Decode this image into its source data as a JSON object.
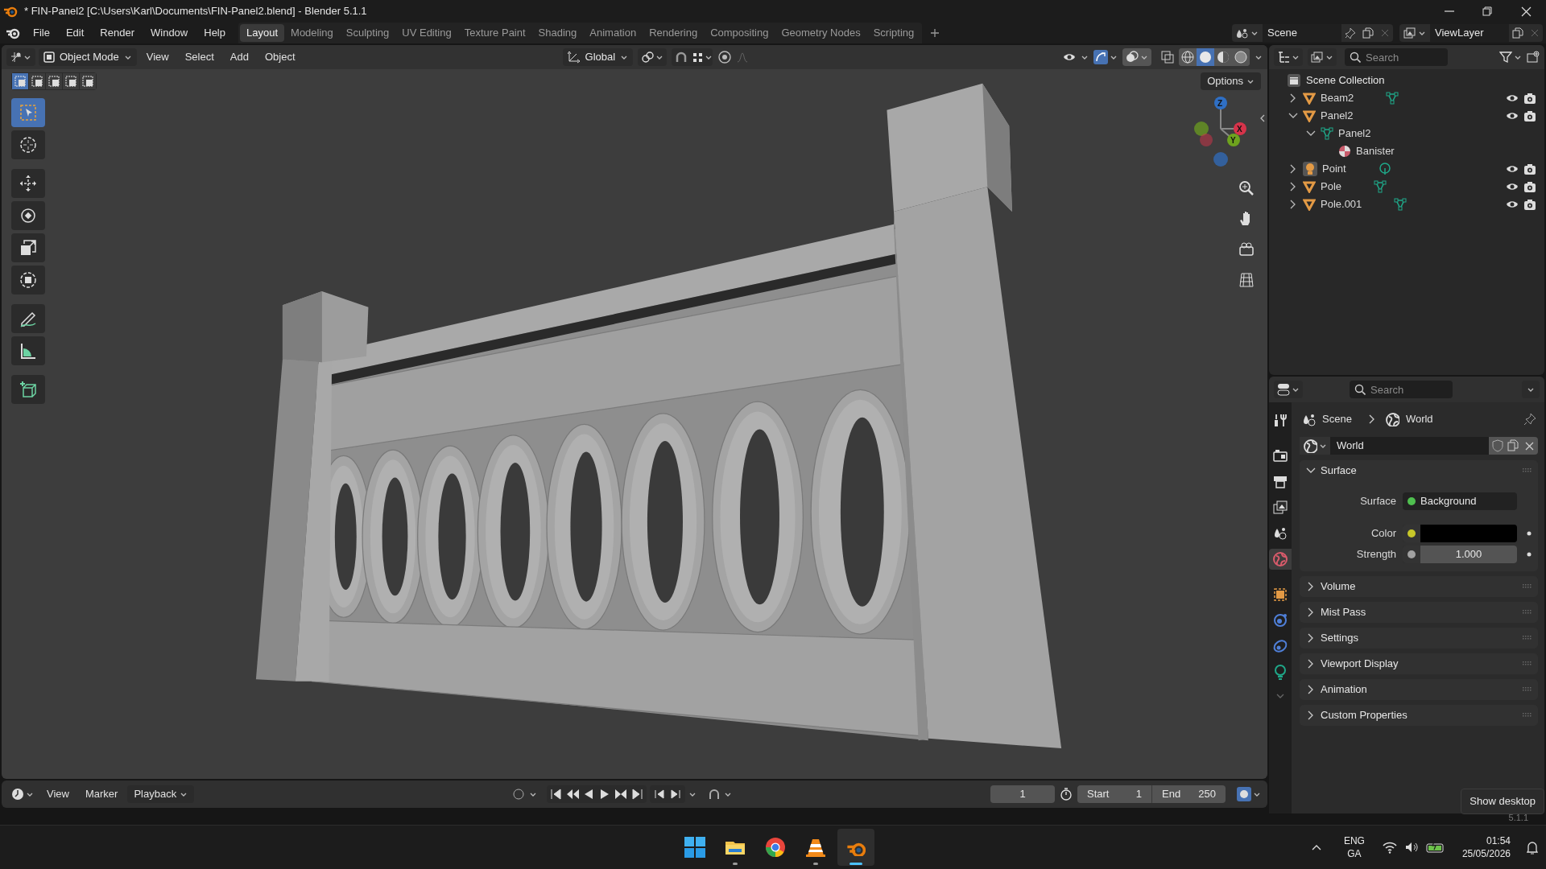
{
  "window": {
    "title": "* FIN-Panel2 [C:\\Users\\Karl\\Documents\\FIN-Panel2.blend] - Blender 5.1.1"
  },
  "menu": [
    "File",
    "Edit",
    "Render",
    "Window",
    "Help"
  ],
  "workspaces": [
    {
      "label": "Layout",
      "selected": true
    },
    {
      "label": "Modeling",
      "selected": false
    },
    {
      "label": "Sculpting",
      "selected": false
    },
    {
      "label": "UV Editing",
      "selected": false
    },
    {
      "label": "Texture Paint",
      "selected": false
    },
    {
      "label": "Shading",
      "selected": false
    },
    {
      "label": "Animation",
      "selected": false
    },
    {
      "label": "Rendering",
      "selected": false
    },
    {
      "label": "Compositing",
      "selected": false
    },
    {
      "label": "Geometry Nodes",
      "selected": false
    },
    {
      "label": "Scripting",
      "selected": false
    }
  ],
  "scene": "Scene",
  "view_layer": "ViewLayer",
  "viewport": {
    "mode": "Object Mode",
    "menus": [
      "View",
      "Select",
      "Add",
      "Object"
    ],
    "orientation": "Global",
    "options": "Options",
    "select_modes": [
      {
        "selected": true
      },
      {
        "selected": false
      },
      {
        "selected": false
      },
      {
        "selected": false
      },
      {
        "selected": false
      }
    ],
    "tools": [
      {
        "kind": "select",
        "selected": true
      },
      {
        "kind": "cursor",
        "selected": false
      },
      {
        "kind": "move",
        "selected": false
      },
      {
        "kind": "rotate",
        "selected": false
      },
      {
        "kind": "scale",
        "selected": false
      },
      {
        "kind": "transform",
        "selected": false
      },
      {
        "kind": "annotate",
        "selected": false
      },
      {
        "kind": "measure",
        "selected": false
      },
      {
        "kind": "add_cube",
        "selected": false
      }
    ],
    "shading": [
      {
        "kind": "wireframe",
        "selected": false
      },
      {
        "kind": "solid",
        "selected": true
      },
      {
        "kind": "material",
        "selected": false
      },
      {
        "kind": "rendered",
        "selected": false
      }
    ],
    "axes": [
      "Z",
      "X",
      "Y"
    ]
  },
  "outliner": {
    "search": {
      "placeholder": "Search"
    },
    "root": "Scene Collection",
    "items": [
      {
        "label": "Beam2",
        "kind": "mesh",
        "expanded": false,
        "visible": true,
        "data_icon": true
      },
      {
        "label": "Panel2",
        "kind": "mesh",
        "expanded": true,
        "visible": true,
        "children": [
          {
            "label": "Panel2",
            "kind": "mesh_data",
            "expanded": true,
            "children": [
              {
                "label": "Banister",
                "kind": "material"
              }
            ]
          }
        ]
      },
      {
        "label": "Point",
        "kind": "light",
        "expanded": false,
        "visible": true,
        "data_icon": true
      },
      {
        "label": "Pole",
        "kind": "mesh",
        "expanded": false,
        "visible": true,
        "data_icon": true
      },
      {
        "label": "Pole.001",
        "kind": "mesh",
        "expanded": false,
        "visible": true,
        "data_icon": true
      }
    ]
  },
  "properties": {
    "search": {
      "placeholder": "Search"
    },
    "breadcrumb": [
      "Scene",
      "World"
    ],
    "datablock": "World",
    "tabs": [
      {
        "kind": "tool",
        "selected": false
      },
      {
        "kind": "render",
        "selected": false
      },
      {
        "kind": "output",
        "selected": false
      },
      {
        "kind": "view_layer",
        "selected": false
      },
      {
        "kind": "scene",
        "selected": false
      },
      {
        "kind": "world",
        "selected": true
      },
      {
        "kind": "object",
        "selected": false
      },
      {
        "kind": "physics",
        "selected": false
      },
      {
        "kind": "constraints",
        "selected": false
      },
      {
        "kind": "data",
        "selected": false
      }
    ],
    "panels": [
      {
        "label": "Surface",
        "expanded": true,
        "fields": [
          {
            "label": "Surface",
            "kind": "shader",
            "value": "Background"
          },
          {
            "label": "Color",
            "kind": "color",
            "color": "#000000"
          },
          {
            "label": "Strength",
            "kind": "number",
            "value": "1.000"
          }
        ]
      },
      {
        "label": "Volume",
        "expanded": false
      },
      {
        "label": "Mist Pass",
        "expanded": false
      },
      {
        "label": "Settings",
        "expanded": false
      },
      {
        "label": "Viewport Display",
        "expanded": false
      },
      {
        "label": "Animation",
        "expanded": false
      },
      {
        "label": "Custom Properties",
        "expanded": false
      }
    ]
  },
  "timeline": {
    "menus": [
      {
        "label": "View",
        "dropdown": false
      },
      {
        "label": "Marker",
        "dropdown": false
      },
      {
        "label": "Playback",
        "dropdown": true
      }
    ],
    "current_frame": "1",
    "start_label": "Start",
    "start": "1",
    "end_label": "End",
    "end": "250"
  },
  "version": "5.1.1",
  "tooltip": "Show desktop",
  "taskbar": {
    "apps": [
      {
        "kind": "files",
        "running": true,
        "selected": false
      },
      {
        "kind": "browser",
        "running": false,
        "selected": false
      },
      {
        "kind": "cone",
        "running": true,
        "selected": false
      },
      {
        "kind": "blender",
        "running": true,
        "selected": true
      }
    ],
    "language": [
      "ENG",
      "GA"
    ],
    "time": "01:54",
    "date": "25/05/2026"
  }
}
